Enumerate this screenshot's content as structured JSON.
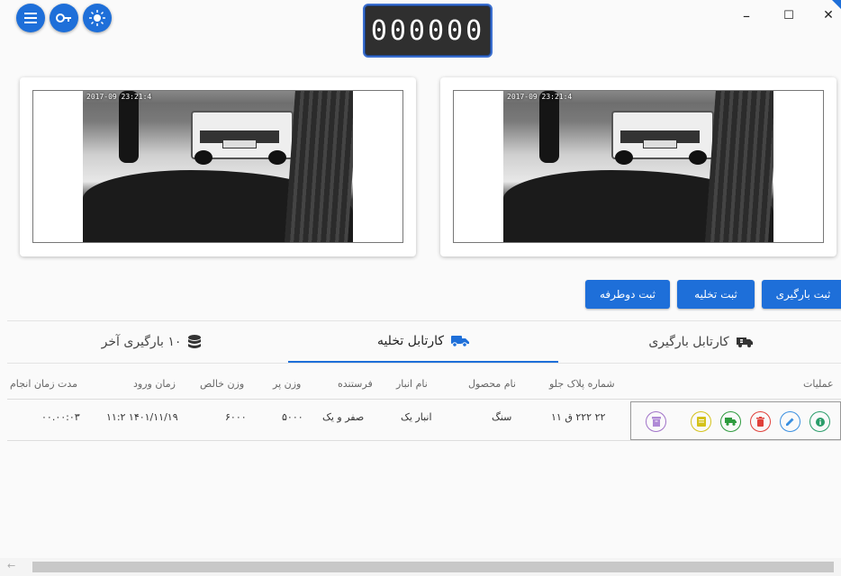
{
  "counter": {
    "value": "000000"
  },
  "window": {
    "minimize": "–",
    "maximize": "☐",
    "close": "✕"
  },
  "toolbar": {
    "icons": [
      "menu-icon",
      "key-icon",
      "brightness-icon"
    ],
    "accent": "#1e6fd9"
  },
  "cameras": [
    {
      "timestamp": "2017-09 23:21:4"
    },
    {
      "timestamp": "2017-09 23:21:4"
    }
  ],
  "actions": {
    "loading": "ثبت بارگیری",
    "unloading": "ثبت تخلیه",
    "two_way": "ثبت دوطرفه"
  },
  "tabs": {
    "loading_tab": "کارتابل بارگیری",
    "unloading_tab": "کارتابل تخلیه",
    "last_ten": "۱۰ بارگیری آخر"
  },
  "table": {
    "headers": {
      "operations": "عملیات",
      "plate": "شماره پلاک جلو",
      "product": "نام محصول",
      "warehouse": "نام انبار",
      "sender": "فرستنده",
      "full_weight": "وزن پر",
      "net_weight": "وزن خالص",
      "entry_time": "زمان ورود",
      "duration": "مدت زمان انجام"
    },
    "rows": [
      {
        "plate": "۲۲ ۲۲۲ ق ۱۱",
        "product": "سنگ",
        "warehouse": "انبار یک",
        "sender": "صفر و یک",
        "full_weight": "۵۰۰۰",
        "net_weight": "۶۰۰۰",
        "entry_time": "۱۱:۲ ۱۴۰۱/۱۱/۱۹",
        "duration": "۰۰.۰۰:۰۳"
      }
    ],
    "op_icons": [
      "info-icon",
      "edit-icon",
      "delete-icon",
      "truck-icon",
      "print-icon",
      "archive-icon"
    ]
  }
}
